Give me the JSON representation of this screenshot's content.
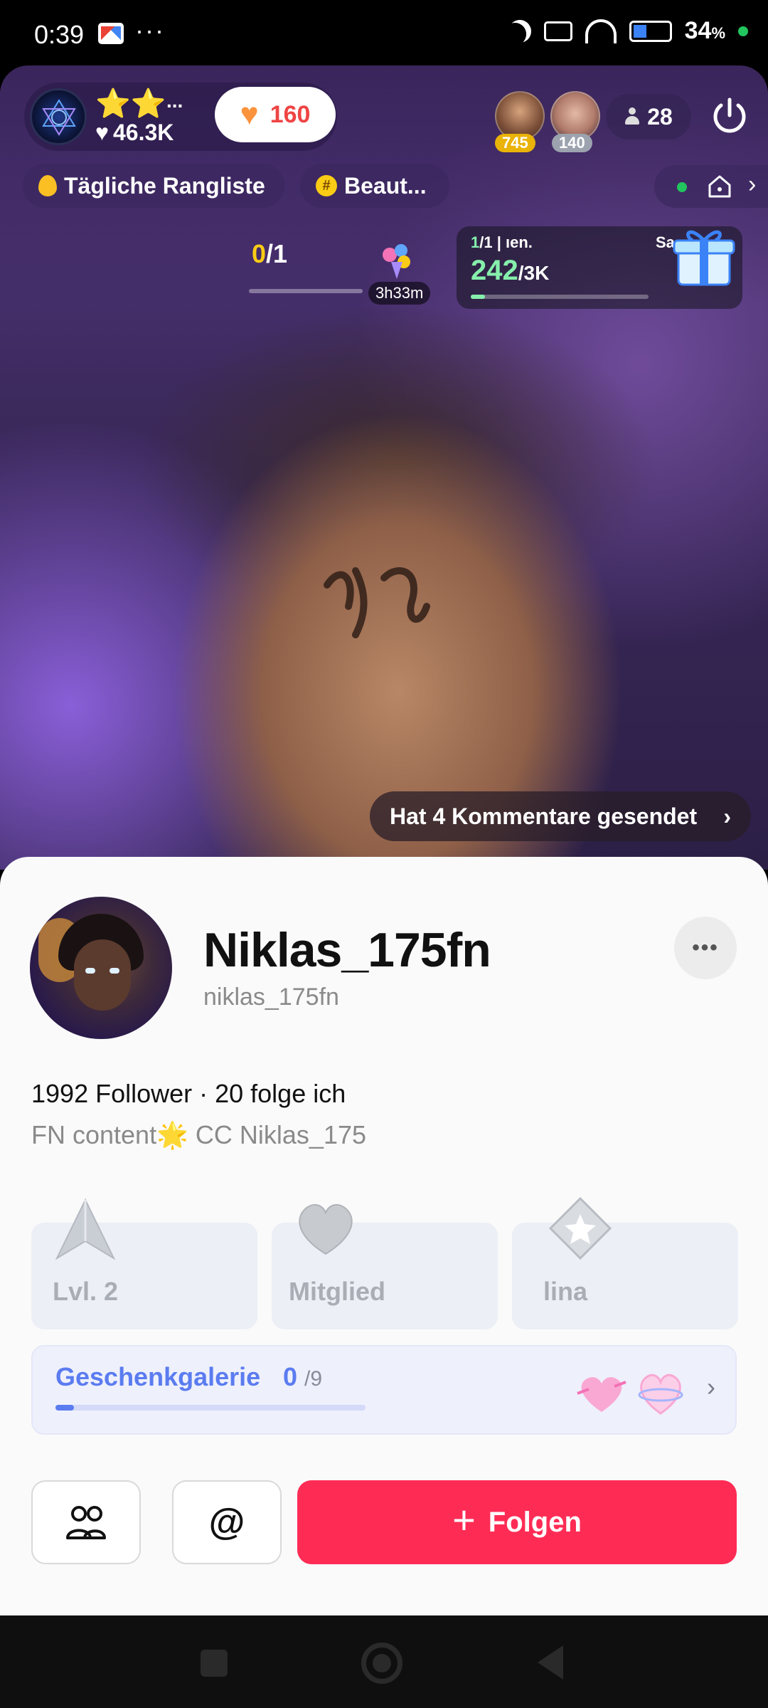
{
  "status_bar": {
    "time": "0:39",
    "dots": "···",
    "battery": "34",
    "battery_unit": "%"
  },
  "stream": {
    "host": {
      "stars": "⭐⭐",
      "stars_more": "...",
      "likes": "46.3K"
    },
    "like_button": {
      "count": "160"
    },
    "viewers": [
      {
        "badge": "745"
      },
      {
        "badge": "140"
      }
    ],
    "viewer_count": "28",
    "chips": {
      "ranking": "Tägliche Rangliste",
      "hashtag": "Beaut..."
    },
    "goal_left": {
      "current": "0",
      "total": "/1",
      "timer": "3h33m"
    },
    "goal_right": {
      "top_current": "1",
      "top_total": "/1",
      "top_label": "| ıen.",
      "top_right": "Sa",
      "value": "242",
      "total": "/3K"
    },
    "comments_toast": "Hat 4 Kommentare gesendet",
    "comments_chevron": "›"
  },
  "profile": {
    "display_name": "Niklas_175fn",
    "username": "niklas_175fn",
    "more": "•••",
    "stats": "1992 Follower · 20 folge ich",
    "bio": "FN content🌟  CC  Niklas_175",
    "badges": [
      {
        "label": "Lvl. 2"
      },
      {
        "label": "Mitglied"
      },
      {
        "label": "lina"
      }
    ],
    "gallery": {
      "title": "Geschenkgalerie",
      "count": "0",
      "total": "/9",
      "progress": 0.06
    },
    "mention_symbol": "@",
    "follow_plus": "+",
    "follow_label": "Folgen"
  },
  "colors": {
    "accent_red": "#fe2c55",
    "gallery_blue": "#5b7cf0",
    "goal_green": "#86efac",
    "like_orange": "#fb923c"
  }
}
